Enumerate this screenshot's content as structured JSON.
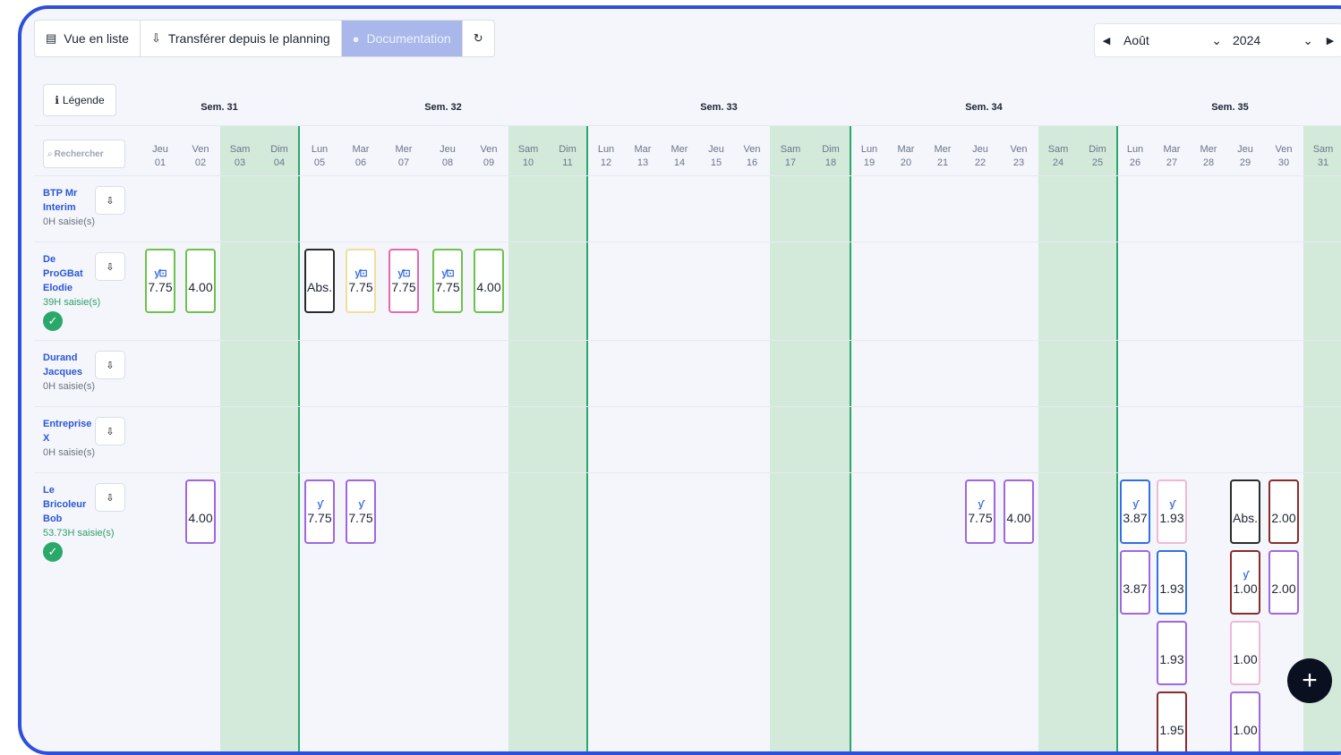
{
  "toolbar": {
    "list_view": "Vue en liste",
    "transfer": "Transférer depuis le planning",
    "documentation": "Documentation"
  },
  "period": {
    "month": "Août",
    "year": "2024"
  },
  "legend_label": "Légende",
  "search": {
    "placeholder": "Rechercher"
  },
  "weeks": [
    "Sem. 31",
    "Sem. 32",
    "Sem. 33",
    "Sem. 34",
    "Sem. 35"
  ],
  "days": [
    {
      "d": "Jeu",
      "n": "01"
    },
    {
      "d": "Ven",
      "n": "02"
    },
    {
      "d": "Sam",
      "n": "03"
    },
    {
      "d": "Dim",
      "n": "04"
    },
    {
      "d": "Lun",
      "n": "05"
    },
    {
      "d": "Mar",
      "n": "06"
    },
    {
      "d": "Mer",
      "n": "07"
    },
    {
      "d": "Jeu",
      "n": "08"
    },
    {
      "d": "Ven",
      "n": "09"
    },
    {
      "d": "Sam",
      "n": "10"
    },
    {
      "d": "Dim",
      "n": "11"
    },
    {
      "d": "Lun",
      "n": "12"
    },
    {
      "d": "Mar",
      "n": "13"
    },
    {
      "d": "Mer",
      "n": "14"
    },
    {
      "d": "Jeu",
      "n": "15"
    },
    {
      "d": "Ven",
      "n": "16"
    },
    {
      "d": "Sam",
      "n": "17"
    },
    {
      "d": "Dim",
      "n": "18"
    },
    {
      "d": "Lun",
      "n": "19"
    },
    {
      "d": "Mar",
      "n": "20"
    },
    {
      "d": "Mer",
      "n": "21"
    },
    {
      "d": "Jeu",
      "n": "22"
    },
    {
      "d": "Ven",
      "n": "23"
    },
    {
      "d": "Sam",
      "n": "24"
    },
    {
      "d": "Dim",
      "n": "25"
    },
    {
      "d": "Lun",
      "n": "26"
    },
    {
      "d": "Mar",
      "n": "27"
    },
    {
      "d": "Mer",
      "n": "28"
    },
    {
      "d": "Jeu",
      "n": "29"
    },
    {
      "d": "Ven",
      "n": "30"
    },
    {
      "d": "Sam",
      "n": "31"
    }
  ],
  "employees": [
    {
      "name": "BTP Mr Interim",
      "hours": "0H saisie(s)",
      "validated": false
    },
    {
      "name": "De ProGBat Elodie",
      "hours": "39H saisie(s)",
      "validated": true
    },
    {
      "name": "Durand Jacques",
      "hours": "0H saisie(s)",
      "validated": false
    },
    {
      "name": "Entreprise X",
      "hours": "0H saisie(s)",
      "validated": false
    },
    {
      "name": "Le Bricoleur Bob",
      "hours": "53.73H saisie(s)",
      "validated": true
    }
  ],
  "entries": [
    {
      "emp": 1,
      "day": 0,
      "slot": 0,
      "value": "7.75",
      "icons": "meal+bus",
      "color": "#6cc24a"
    },
    {
      "emp": 1,
      "day": 1,
      "slot": 0,
      "value": "4.00",
      "icons": "",
      "color": "#6cc24a"
    },
    {
      "emp": 1,
      "day": 4,
      "slot": 0,
      "value": "Abs.",
      "icons": "",
      "color": "#2b2b2b"
    },
    {
      "emp": 1,
      "day": 5,
      "slot": 0,
      "value": "7.75",
      "icons": "meal+bus",
      "color": "#f0de9a"
    },
    {
      "emp": 1,
      "day": 6,
      "slot": 0,
      "value": "7.75",
      "icons": "meal+bus",
      "color": "#e868b0"
    },
    {
      "emp": 1,
      "day": 7,
      "slot": 0,
      "value": "7.75",
      "icons": "meal+bus",
      "color": "#6cc24a"
    },
    {
      "emp": 1,
      "day": 8,
      "slot": 0,
      "value": "4.00",
      "icons": "",
      "color": "#6cc24a"
    },
    {
      "emp": 4,
      "day": 1,
      "slot": 0,
      "value": "4.00",
      "icons": "",
      "color": "#a066e0"
    },
    {
      "emp": 4,
      "day": 4,
      "slot": 0,
      "value": "7.75",
      "icons": "meal",
      "color": "#a066e0"
    },
    {
      "emp": 4,
      "day": 5,
      "slot": 0,
      "value": "7.75",
      "icons": "meal",
      "color": "#a066e0"
    },
    {
      "emp": 4,
      "day": 21,
      "slot": 0,
      "value": "7.75",
      "icons": "meal",
      "color": "#a066e0"
    },
    {
      "emp": 4,
      "day": 22,
      "slot": 0,
      "value": "4.00",
      "icons": "",
      "color": "#a066e0"
    },
    {
      "emp": 4,
      "day": 25,
      "slot": 0,
      "value": "3.87",
      "icons": "meal",
      "color": "#2f6fe8"
    },
    {
      "emp": 4,
      "day": 25,
      "slot": 1,
      "value": "3.87",
      "icons": "",
      "color": "#a066e0"
    },
    {
      "emp": 4,
      "day": 26,
      "slot": 0,
      "value": "1.93",
      "icons": "meal",
      "color": "#f0b8d8"
    },
    {
      "emp": 4,
      "day": 26,
      "slot": 1,
      "value": "1.93",
      "icons": "",
      "color": "#2f6fe8"
    },
    {
      "emp": 4,
      "day": 26,
      "slot": 2,
      "value": "1.93",
      "icons": "",
      "color": "#a066e0"
    },
    {
      "emp": 4,
      "day": 26,
      "slot": 3,
      "value": "1.95",
      "icons": "",
      "color": "#8a2c2c"
    },
    {
      "emp": 4,
      "day": 28,
      "slot": 0,
      "value": "Abs.",
      "icons": "",
      "color": "#2b2b2b"
    },
    {
      "emp": 4,
      "day": 28,
      "slot": 1,
      "value": "1.00",
      "icons": "meal",
      "color": "#8a2c2c"
    },
    {
      "emp": 4,
      "day": 28,
      "slot": 2,
      "value": "1.00",
      "icons": "",
      "color": "#f0b8d8"
    },
    {
      "emp": 4,
      "day": 28,
      "slot": 3,
      "value": "1.00",
      "icons": "",
      "color": "#a066e0"
    },
    {
      "emp": 4,
      "day": 29,
      "slot": 0,
      "value": "2.00",
      "icons": "",
      "color": "#8a2c2c"
    },
    {
      "emp": 4,
      "day": 29,
      "slot": 1,
      "value": "2.00",
      "icons": "",
      "color": "#a066e0"
    }
  ],
  "icons": {
    "list": "list-icon",
    "transfer": "transfer-icon",
    "info": "info-icon",
    "refresh": "refresh-icon",
    "meal": "meal-icon",
    "bus": "bus-icon",
    "add": "add-icon",
    "check": "check-icon"
  }
}
